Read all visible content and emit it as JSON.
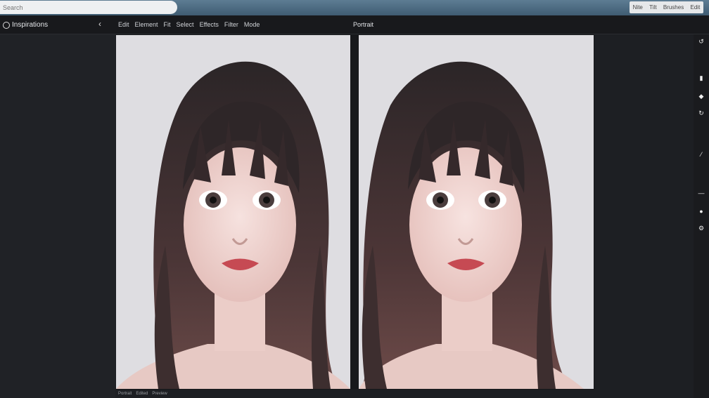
{
  "browser": {
    "search_placeholder": "Search",
    "top_right": [
      "Nite",
      "Tilt",
      "Brushes",
      "Edit"
    ]
  },
  "app": {
    "name": "Inspirations",
    "menu": [
      "Edit",
      "Element",
      "Fit",
      "Select",
      "Effects",
      "Filter",
      "Mode"
    ],
    "document_title": "Portrait"
  },
  "status": [
    "Portrait",
    "Edited",
    "Preview"
  ],
  "colors": {
    "topbar": "#4d6b82",
    "canvas_bg": "#dedde1",
    "ui_dark": "#1d1f23"
  }
}
